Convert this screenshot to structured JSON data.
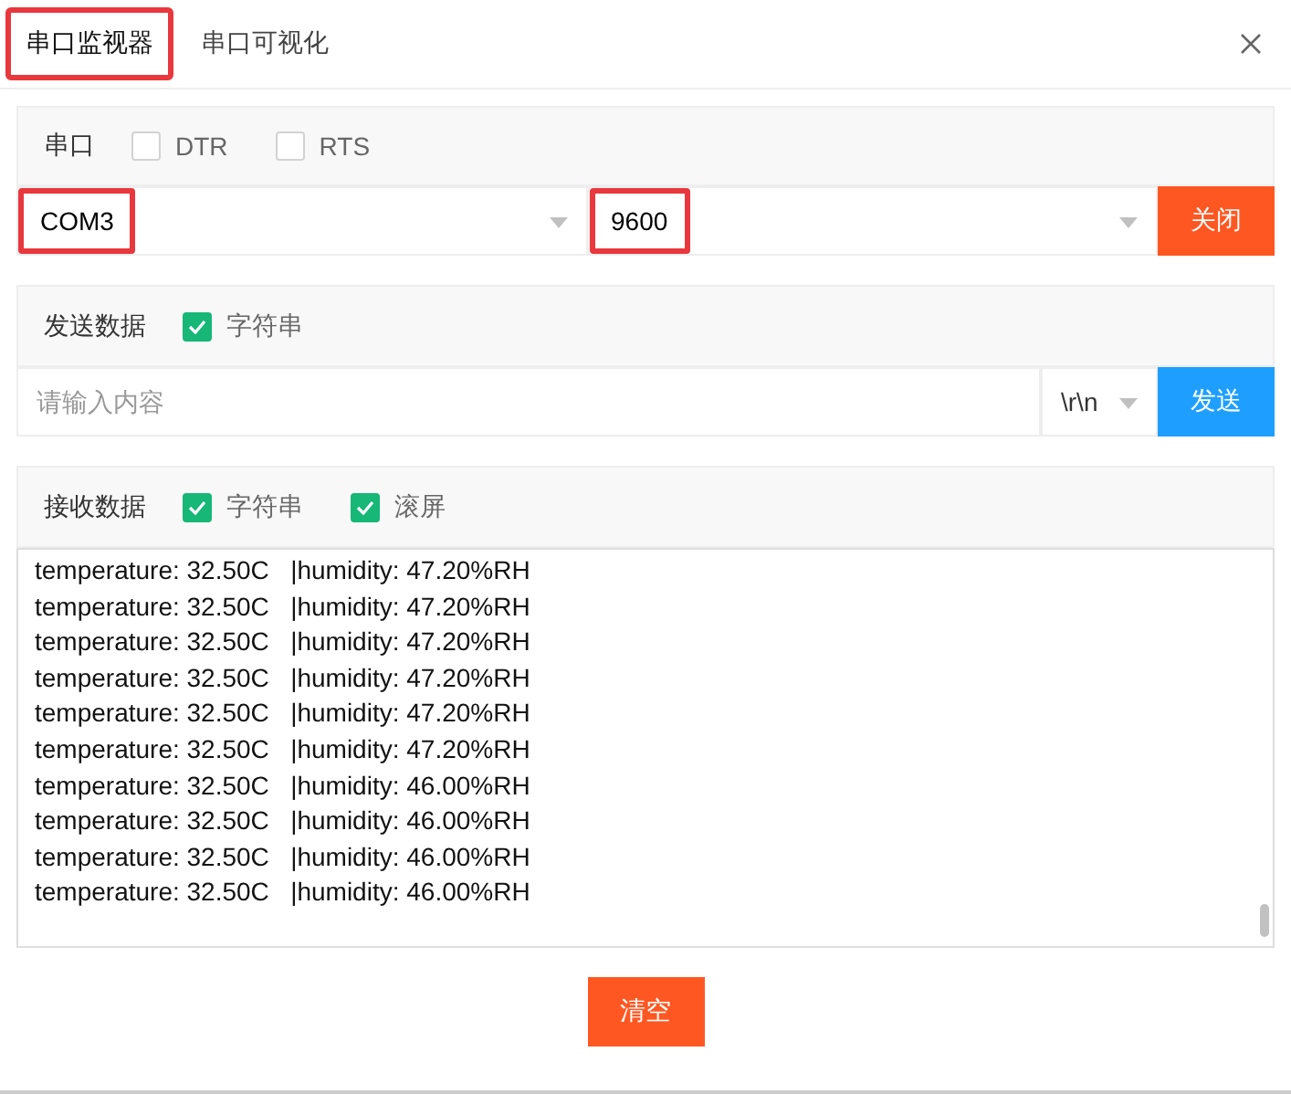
{
  "tabs": [
    {
      "label": "串口监视器",
      "selected": true,
      "highlighted": true
    },
    {
      "label": "串口可视化",
      "selected": false,
      "highlighted": false
    }
  ],
  "port_section": {
    "title": "串口",
    "options": [
      {
        "label": "DTR",
        "checked": false
      },
      {
        "label": "RTS",
        "checked": false
      }
    ],
    "port_select": {
      "value": "COM3",
      "highlighted": true
    },
    "baud_select": {
      "value": "9600",
      "highlighted": true
    },
    "button": "关闭"
  },
  "send_section": {
    "title": "发送数据",
    "options": [
      {
        "label": "字符串",
        "checked": true
      }
    ],
    "input": {
      "placeholder": "请输入内容"
    },
    "line_ending": "\\r\\n",
    "button": "发送"
  },
  "receive_section": {
    "title": "接收数据",
    "options": [
      {
        "label": "字符串",
        "checked": true
      },
      {
        "label": "滚屏",
        "checked": true
      }
    ],
    "lines": [
      "temperature: 32.50C   |humidity: 47.20%RH",
      "temperature: 32.50C   |humidity: 47.20%RH",
      "temperature: 32.50C   |humidity: 47.20%RH",
      "temperature: 32.50C   |humidity: 47.20%RH",
      "temperature: 32.50C   |humidity: 47.20%RH",
      "temperature: 32.50C   |humidity: 47.20%RH",
      "temperature: 32.50C   |humidity: 46.00%RH",
      "temperature: 32.50C   |humidity: 46.00%RH",
      "temperature: 32.50C   |humidity: 46.00%RH",
      "temperature: 32.50C   |humidity: 46.00%RH"
    ]
  },
  "clear_button": "清空"
}
